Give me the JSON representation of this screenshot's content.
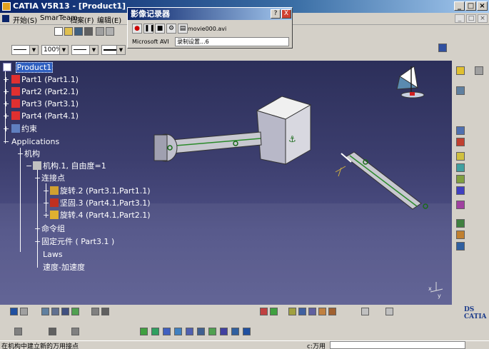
{
  "window": {
    "title": "CATIA V5R13 - [Product1]"
  },
  "menu": {
    "items": [
      "开始(S)",
      "SmarTeam",
      "档案(F)",
      "编辑(E)"
    ]
  },
  "toolbar": {
    "zoom_value": "100%"
  },
  "dialog": {
    "title": "影像记录器",
    "help_label": "?",
    "close_label": "X",
    "filename": "movie000.avi",
    "codec": "Microsoft AVI",
    "setup_label": "录制设置...6"
  },
  "tree": {
    "product": "Product1",
    "parts": [
      "Part1 (Part1.1)",
      "Part2 (Part2.1)",
      "Part3 (Part3.1)",
      "Part4 (Part4.1)"
    ],
    "constraints": "约束",
    "applications": "Applications",
    "mechanisms": "机构",
    "mechanism": "机构.1, 自由度=1",
    "joints": "连接点",
    "joint_items": [
      "旋转.2 (Part3.1,Part1.1)",
      "坚固.3 (Part4.1,Part3.1)",
      "旋转.4 (Part4.1,Part2.1)"
    ],
    "commands": "命令组",
    "fixed_part": "固定元件 ( Part3.1 )",
    "laws": "Laws",
    "speed_accel": "速度-加速度"
  },
  "status": {
    "message": "在机构中建立新的万用接点",
    "cmd_label": "c:万用"
  },
  "colors": {
    "viewport_top": "#2c2f5a",
    "viewport_bottom": "#5a5c90",
    "selection": "#3060c0",
    "title_dark": "#0a246a"
  }
}
